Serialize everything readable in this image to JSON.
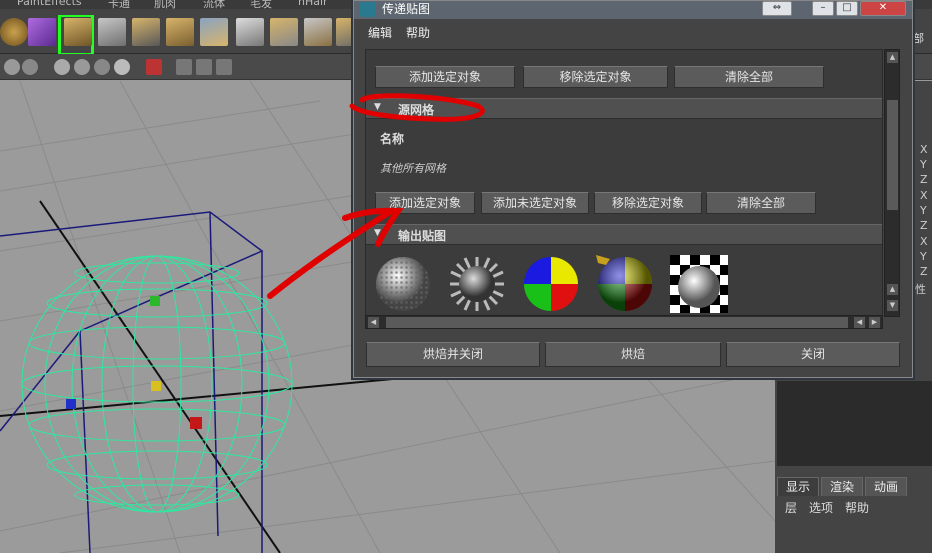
{
  "app": {
    "menu_strip": [
      "PaintEffects",
      "卡通",
      "肌肉",
      "流体",
      "毛发",
      "nHair"
    ]
  },
  "window": {
    "title": "传递贴图",
    "menu": [
      "编辑",
      "帮助"
    ],
    "top_buttons": [
      "添加选定对象",
      "移除选定对象",
      "清除全部"
    ],
    "source_mesh": {
      "header": "源网格",
      "name_label": "名称",
      "other_meshes": "其他所有网格",
      "buttons": [
        "添加选定对象",
        "添加未选定对象",
        "移除选定对象",
        "清除全部"
      ]
    },
    "output_maps": {
      "header": "输出贴图",
      "thumbnails": [
        "normal-map-sphere",
        "displacement-spiky-sphere",
        "color-quadrant-disc",
        "shaded-quadrant-sphere",
        "checker-ao-sphere"
      ]
    },
    "footer_buttons": [
      "烘焙并关闭",
      "烘焙",
      "关闭"
    ]
  },
  "channel_box": {
    "axes": [
      "X",
      "Y",
      "Z",
      "X",
      "Y",
      "Z",
      "X",
      "Y",
      "Z",
      "性"
    ],
    "corner_label": "部",
    "layer_tabs": [
      "显示",
      "渲染",
      "动画"
    ],
    "layer_menu": [
      "层",
      "选项",
      "帮助"
    ]
  },
  "colors": {
    "wireframe": "#2ee8a0",
    "annotation": "#e00000",
    "window_bg": "#444444"
  }
}
